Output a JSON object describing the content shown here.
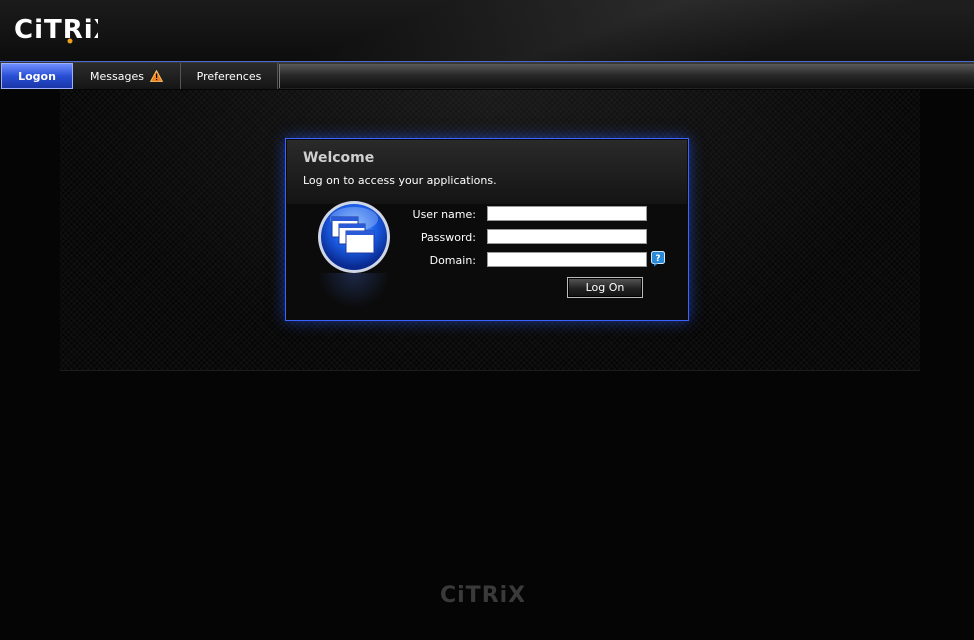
{
  "header": {
    "logo_text": "CiTRiX",
    "logo_alt": "Citrix"
  },
  "tabs": [
    {
      "label": "Logon",
      "active": true
    },
    {
      "label": "Messages",
      "active": false,
      "icon": "warning-icon"
    },
    {
      "label": "Preferences",
      "active": false
    }
  ],
  "login": {
    "title": "Welcome",
    "subtitle": "Log on to access your applications.",
    "username_label": "User name:",
    "password_label": "Password:",
    "domain_label": "Domain:",
    "username_value": "",
    "password_value": "",
    "domain_value": "",
    "button_label": "Log On",
    "help_icon": "help-icon"
  },
  "footer": {
    "logo_text": "CiTRiX"
  },
  "colors": {
    "accent": "#3b63ff",
    "tab_active": "#2a4fd6",
    "warning": "#f0a020"
  }
}
